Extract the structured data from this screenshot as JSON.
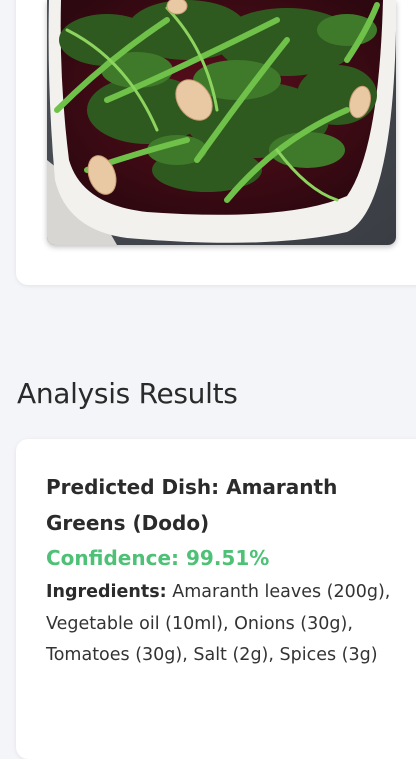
{
  "image": {
    "alt": "Amaranth greens (Dodo) with garlic in a white dish"
  },
  "results": {
    "heading": "Analysis Results",
    "predicted_label": "Predicted Dish:",
    "predicted_value": "Amaranth Greens (Dodo)",
    "confidence_label": "Confidence:",
    "confidence_value": "99.51%",
    "ingredients_label": "Ingredients:",
    "ingredients_value": "Amaranth leaves (200g), Vegetable oil (10ml), Onions (30g), Tomatoes (30g), Salt (2g), Spices (3g)"
  },
  "colors": {
    "page_background": "#f4f5f9",
    "card_background": "#ffffff",
    "confidence_green": "#4ec177",
    "text_dark": "#2b2b2b"
  }
}
